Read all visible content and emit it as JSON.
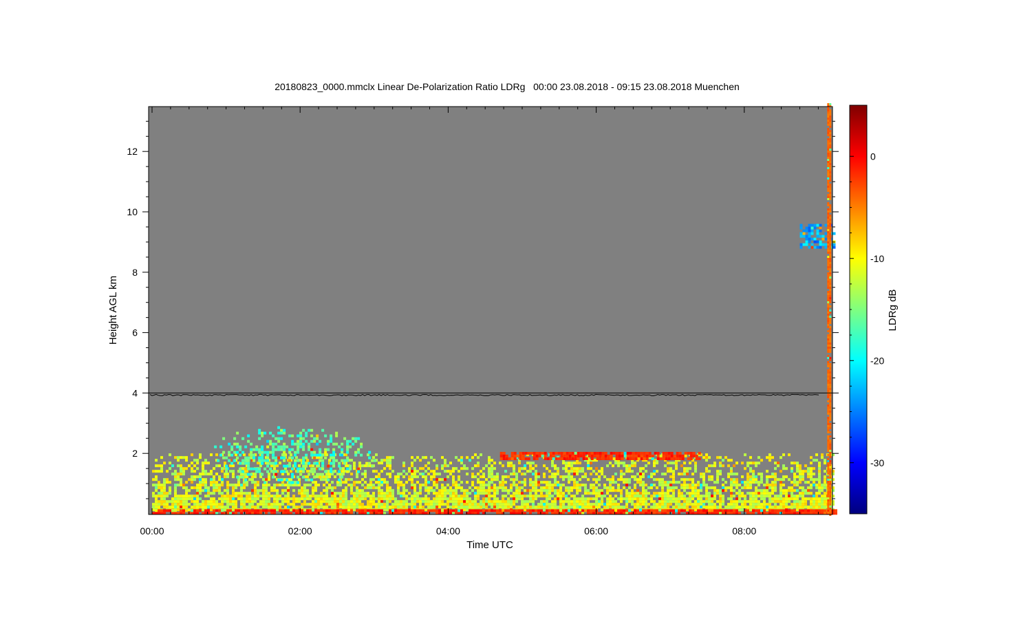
{
  "chart_data": {
    "type": "heatmap",
    "title": "20180823_0000.mmclx Linear De-Polarization Ratio LDRg   00:00 23.08.2018 - 09:15 23.08.2018 Muenchen",
    "xlabel": "Time UTC",
    "ylabel": "Height AGL km",
    "colorbar_label": "LDRg dB",
    "x_unit": "hours UTC",
    "xlim": [
      0,
      9.25
    ],
    "ylim": [
      0,
      13.6
    ],
    "x_ticks": [
      {
        "value": 0,
        "label": "00:00"
      },
      {
        "value": 2,
        "label": "02:00"
      },
      {
        "value": 4,
        "label": "04:00"
      },
      {
        "value": 6,
        "label": "06:00"
      },
      {
        "value": 8,
        "label": "08:00"
      }
    ],
    "y_ticks": [
      {
        "value": 2,
        "label": "2"
      },
      {
        "value": 4,
        "label": "4"
      },
      {
        "value": 6,
        "label": "6"
      },
      {
        "value": 8,
        "label": "8"
      },
      {
        "value": 10,
        "label": "10"
      },
      {
        "value": 12,
        "label": "12"
      }
    ],
    "colorbar": {
      "range": [
        -35,
        5
      ],
      "ticks": [
        {
          "value": 0,
          "label": "0"
        },
        {
          "value": -10,
          "label": "-10"
        },
        {
          "value": -20,
          "label": "-20"
        },
        {
          "value": -30,
          "label": "-30"
        }
      ],
      "colormap": "jet"
    },
    "background_color": "#808080",
    "reference_line_height_km": 4.0,
    "regions": [
      {
        "name": "boundary layer echoes",
        "t_start": 0.0,
        "t_end": 9.2,
        "h_bottom": 0.1,
        "h_top": 2.0,
        "ldr_typical": [
          -14,
          -8
        ]
      },
      {
        "name": "elevated echoes",
        "t_start": 0.8,
        "t_end": 3.0,
        "h_bottom": 1.0,
        "h_top": 2.9,
        "ldr_typical": [
          -20,
          -13
        ]
      },
      {
        "name": "ground clutter band",
        "t_start": 0.0,
        "t_end": 9.25,
        "h_bottom": 0.05,
        "h_top": 0.15,
        "ldr_typical": [
          -3,
          0
        ]
      },
      {
        "name": "layer near 2 km",
        "t_start": 4.7,
        "t_end": 7.4,
        "h_bottom": 1.85,
        "h_top": 2.05,
        "ldr_typical": [
          -3,
          0
        ]
      },
      {
        "name": "upper cloud",
        "t_start": 8.75,
        "t_end": 9.2,
        "h_bottom": 8.8,
        "h_top": 9.6,
        "ldr_typical": [
          -27,
          -20
        ]
      },
      {
        "name": "vertical streak",
        "t_start": 9.12,
        "t_end": 9.15,
        "h_bottom": 0.0,
        "h_top": 13.6,
        "ldr_typical": [
          -5,
          -3
        ]
      }
    ]
  }
}
